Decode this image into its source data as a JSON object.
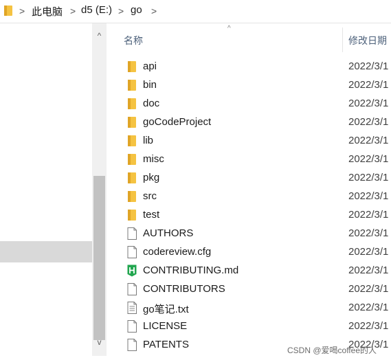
{
  "breadcrumb": {
    "items": [
      "此电脑",
      "d5 (E:)",
      "go"
    ],
    "separator": ">"
  },
  "columns": {
    "name": "名称",
    "date": "修改日期"
  },
  "scrollbar": {
    "up": "^",
    "down": "v"
  },
  "sort_indicator": "^",
  "files": [
    {
      "name": "api",
      "date": "2022/3/1",
      "icon": "folder-icon"
    },
    {
      "name": "bin",
      "date": "2022/3/1",
      "icon": "folder-icon"
    },
    {
      "name": "doc",
      "date": "2022/3/1",
      "icon": "folder-icon"
    },
    {
      "name": "goCodeProject",
      "date": "2022/3/1",
      "icon": "folder-icon"
    },
    {
      "name": "lib",
      "date": "2022/3/1",
      "icon": "folder-icon"
    },
    {
      "name": "misc",
      "date": "2022/3/1",
      "icon": "folder-icon"
    },
    {
      "name": "pkg",
      "date": "2022/3/1",
      "icon": "folder-icon"
    },
    {
      "name": "src",
      "date": "2022/3/1",
      "icon": "folder-icon"
    },
    {
      "name": "test",
      "date": "2022/3/1",
      "icon": "folder-icon"
    },
    {
      "name": "AUTHORS",
      "date": "2022/3/1",
      "icon": "file-icon"
    },
    {
      "name": "codereview.cfg",
      "date": "2022/3/1",
      "icon": "file-icon"
    },
    {
      "name": "CONTRIBUTING.md",
      "date": "2022/3/1",
      "icon": "markdown-file-icon"
    },
    {
      "name": "CONTRIBUTORS",
      "date": "2022/3/1",
      "icon": "file-icon"
    },
    {
      "name": "go笔记.txt",
      "date": "2022/3/1",
      "icon": "text-file-icon"
    },
    {
      "name": "LICENSE",
      "date": "2022/3/1",
      "icon": "file-icon"
    },
    {
      "name": "PATENTS",
      "date": "2022/3/1",
      "icon": "file-icon"
    }
  ],
  "colors": {
    "folder": "#f5c342",
    "folder_dark": "#e0a526",
    "markdown": "#22a64f",
    "header_text": "#4c607a",
    "selection": "#d9d9d9"
  },
  "watermark": "CSDN @爱喝coffee的人"
}
